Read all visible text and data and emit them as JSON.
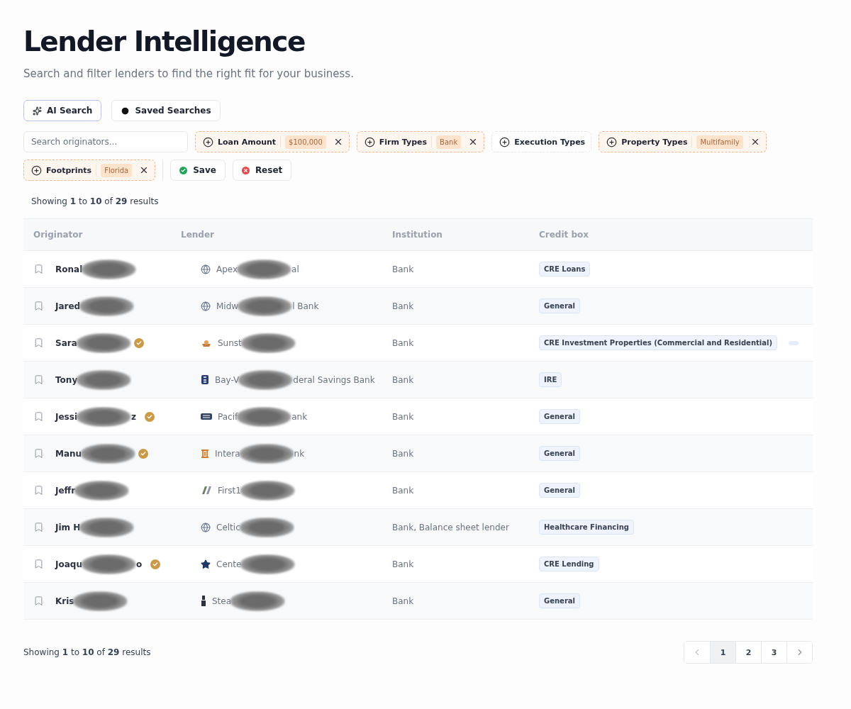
{
  "header": {
    "title": "Lender Intelligence",
    "subtitle": "Search and filter lenders to find the right fit for your business."
  },
  "top_buttons": [
    {
      "label": "AI Search",
      "kind": "ai",
      "selected": true
    },
    {
      "label": "Saved Searches",
      "kind": "saved",
      "selected": false
    }
  ],
  "search": {
    "placeholder": "Search originators..."
  },
  "filters": [
    {
      "label": "Loan Amount",
      "value": "$100,000",
      "active": true
    },
    {
      "label": "Firm Types",
      "value": "Bank",
      "active": true
    },
    {
      "label": "Execution Types",
      "active": false
    },
    {
      "label": "Property Types",
      "value": "Multifamily",
      "active": true
    },
    {
      "label": "Footprints",
      "value": "Florida",
      "active": true
    }
  ],
  "actions": [
    {
      "label": "Save",
      "kind": "save"
    },
    {
      "label": "Reset",
      "kind": "reset"
    }
  ],
  "summary_top": "Showing **1** to **10** of **29** results",
  "table": {
    "columns": [
      "Originator",
      "Lender",
      "Institution",
      "Credit box"
    ],
    "rows": [
      {
        "originator": {
          "start": "Ronal"
        },
        "verified": false,
        "lender": {
          "kind": "globe",
          "start": "Apex",
          "end": "al"
        },
        "institution": "Bank",
        "credit_box": "CRE Loans",
        "more_tags": false
      },
      {
        "originator": {
          "start": "Jared"
        },
        "verified": false,
        "lender": {
          "kind": "globe",
          "start": "Midw",
          "end": "l Bank"
        },
        "institution": "Bank",
        "credit_box": "General",
        "more_tags": false
      },
      {
        "originator": {
          "start": "Sara"
        },
        "verified": true,
        "lender": {
          "kind": "sun",
          "start": "Sunst"
        },
        "institution": "Bank",
        "credit_box": "CRE Investment Properties (Commercial and Residential)",
        "more_tags": true
      },
      {
        "originator": {
          "start": "Tony"
        },
        "verified": false,
        "lender": {
          "kind": "shield",
          "start": "Bay-V",
          "end": "deral Savings Bank"
        },
        "institution": "Bank",
        "credit_box": "IRE",
        "more_tags": false
      },
      {
        "originator": {
          "start": "Jessi",
          "end": "z"
        },
        "verified": true,
        "lender": {
          "kind": "wordmark",
          "start": "Pacif",
          "end": "ank"
        },
        "institution": "Bank",
        "credit_box": "General",
        "more_tags": false
      },
      {
        "originator": {
          "start": "Manu"
        },
        "verified": true,
        "lender": {
          "kind": "pillar",
          "start": "Intera",
          "end": "nk"
        },
        "institution": "Bank",
        "credit_box": "General",
        "more_tags": false
      },
      {
        "originator": {
          "start": "Jeffr"
        },
        "verified": false,
        "lender": {
          "kind": "mark",
          "start": "First1"
        },
        "institution": "Bank",
        "credit_box": "General",
        "more_tags": false
      },
      {
        "originator": {
          "start": "Jim H"
        },
        "verified": false,
        "lender": {
          "kind": "globe",
          "start": "Celtic"
        },
        "institution": "Bank, Balance sheet lender",
        "credit_box": "Healthcare Financing",
        "more_tags": false
      },
      {
        "originator": {
          "start": "Joaqu",
          "end": "o"
        },
        "verified": true,
        "lender": {
          "kind": "star",
          "start": "Cente"
        },
        "institution": "Bank",
        "credit_box": "CRE Lending",
        "more_tags": false
      },
      {
        "originator": {
          "start": "Kris"
        },
        "verified": false,
        "lender": {
          "kind": "tower",
          "start": "Stea"
        },
        "institution": "Bank",
        "credit_box": "General",
        "more_tags": false
      }
    ]
  },
  "summary_bottom": "Showing **1** to **10** of **29** results",
  "pagination": {
    "pages": [
      {
        "label": "1",
        "selected": true
      },
      {
        "label": "2",
        "selected": false
      },
      {
        "label": "3",
        "selected": false
      }
    ]
  }
}
